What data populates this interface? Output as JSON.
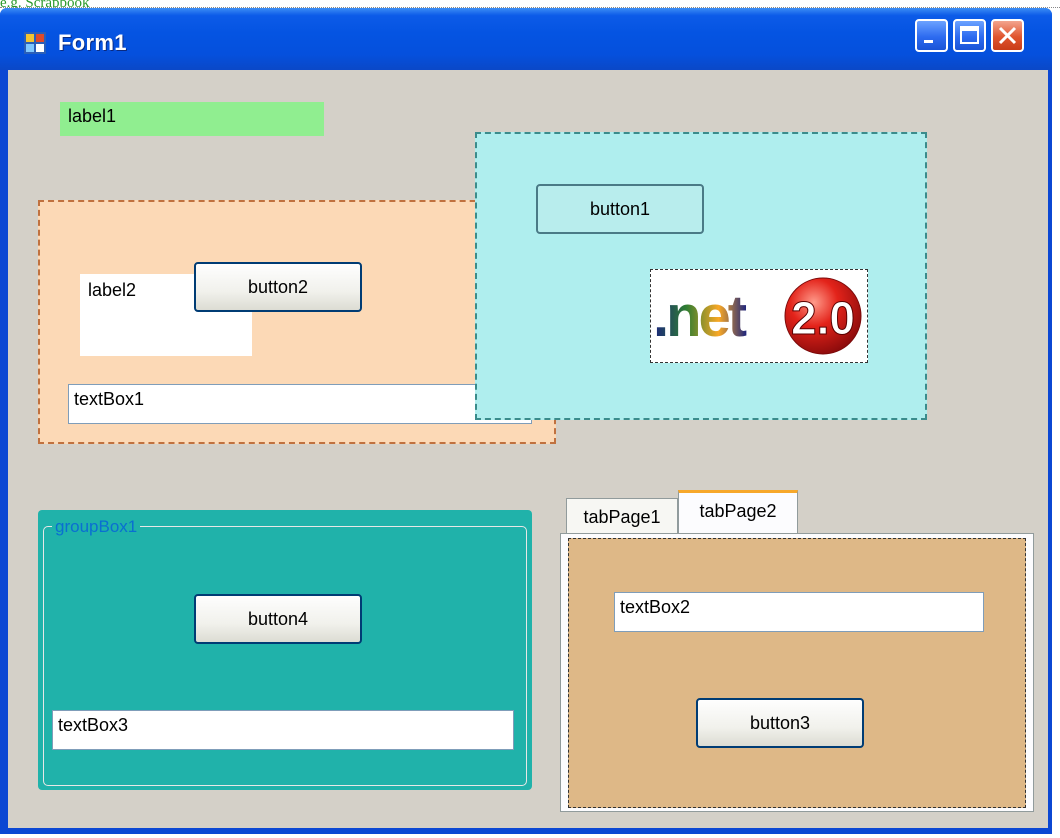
{
  "caption": "e.g. Scrapbook",
  "window": {
    "title": "Form1"
  },
  "label1": "label1",
  "panel1": {
    "label2": "label2",
    "button2": "button2",
    "textbox1": "textBox1"
  },
  "panel2": {
    "button1": "button1",
    "logo_text": ".net",
    "logo_version": "2.0"
  },
  "groupbox": {
    "title": "groupBox1",
    "button4": "button4",
    "textbox3": "textBox3"
  },
  "tabs": {
    "items": [
      "tabPage1",
      "tabPage2"
    ],
    "selected": "tabPage2",
    "textbox2": "textBox2",
    "button3": "button3"
  },
  "colors": {
    "label1_bg": "#90ee90",
    "panel1_bg": "#fcd9b6",
    "panel2_bg": "#afeeee",
    "groupbox_bg": "#20b2aa",
    "tab_page_bg": "#deb887",
    "form_bg": "#d4d0c8"
  }
}
